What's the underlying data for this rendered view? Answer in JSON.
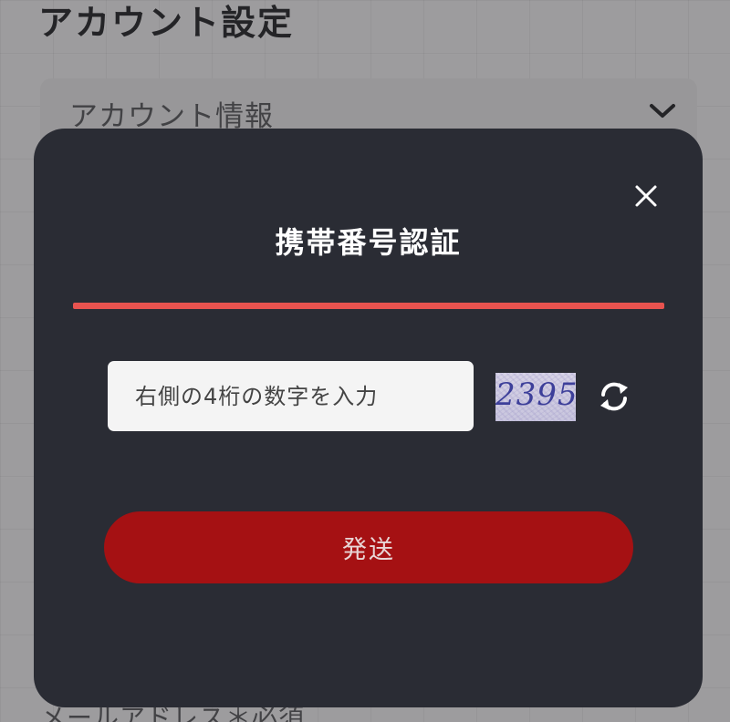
{
  "background": {
    "page_title": "アカウント設定",
    "accordion_label": "アカウント情報",
    "bottom_label": "メールアドレス＊必須"
  },
  "modal": {
    "title": "携帯番号認証",
    "input_placeholder": "右側の4桁の数字を入力",
    "captcha_code": "2395",
    "send_label": "発送"
  },
  "icons": {
    "accordion": "chevron-down-icon",
    "close": "close-icon",
    "refresh": "refresh-icon"
  },
  "colors": {
    "modal_bg": "#2a2c34",
    "divider": "#e8534f",
    "send_button": "#a51113"
  }
}
